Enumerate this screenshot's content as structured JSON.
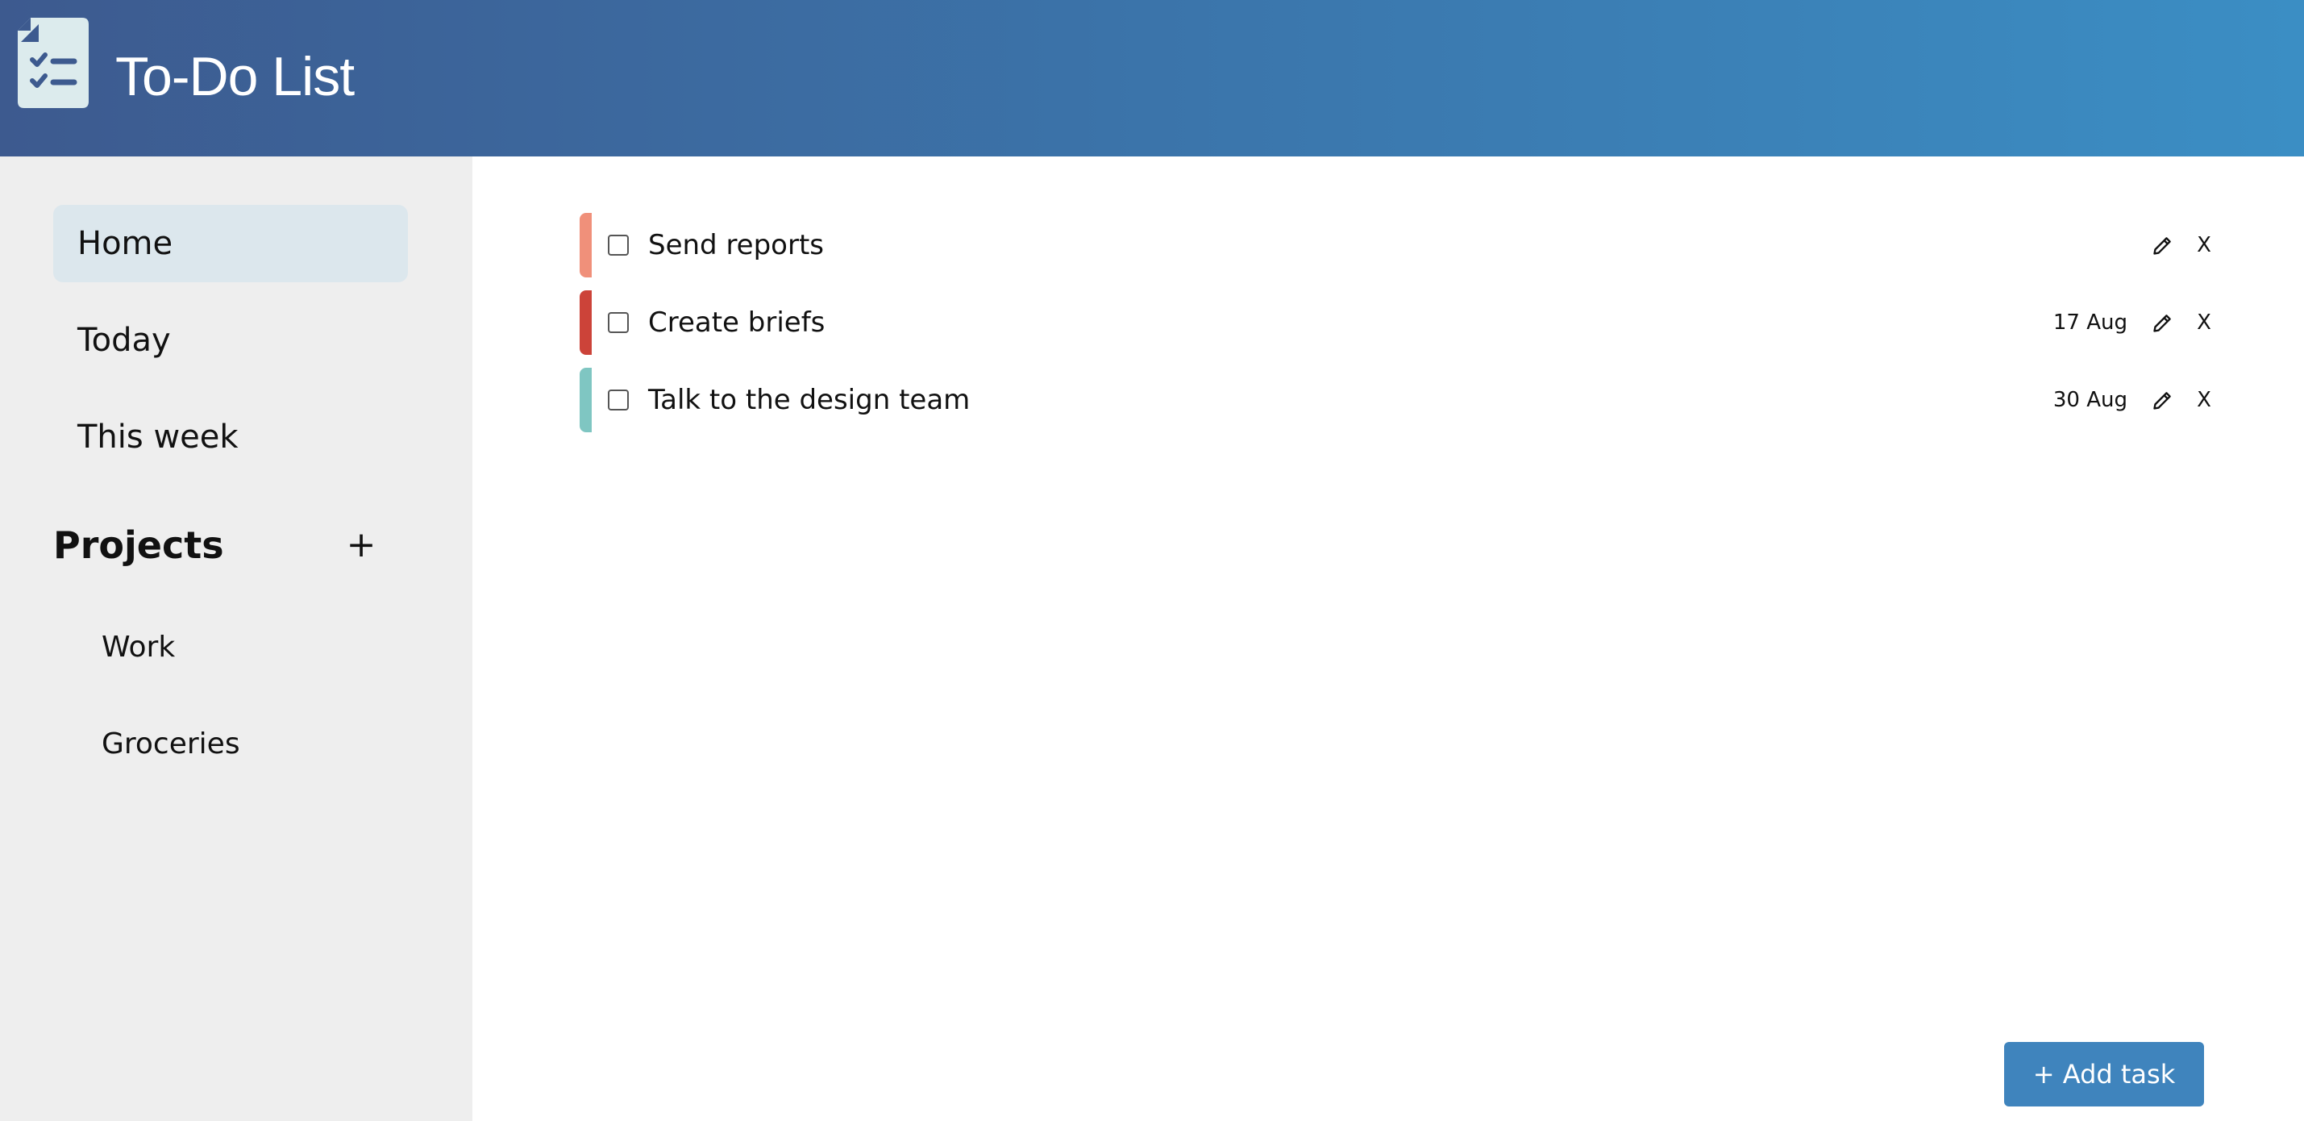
{
  "header": {
    "title": "To-Do List",
    "logo_icon": "checklist-document-icon",
    "gradient_colors": [
      "#3d5a8f",
      "#3b8ec4"
    ]
  },
  "sidebar": {
    "nav_items": [
      {
        "label": "Home",
        "active": true
      },
      {
        "label": "Today",
        "active": false
      },
      {
        "label": "This week",
        "active": false
      }
    ],
    "projects_heading": "Projects",
    "add_project_label": "+",
    "projects": [
      {
        "label": "Work"
      },
      {
        "label": "Groceries"
      }
    ]
  },
  "tasks": [
    {
      "title": "Send reports",
      "date": "",
      "color": "#f0907a",
      "completed": false,
      "edit_icon": "pencil-icon",
      "delete_label": "X"
    },
    {
      "title": "Create briefs",
      "date": "17 Aug",
      "color": "#cc4339",
      "completed": false,
      "edit_icon": "pencil-icon",
      "delete_label": "X"
    },
    {
      "title": "Talk to the design team",
      "date": "30 Aug",
      "color": "#7fc6c2",
      "completed": false,
      "edit_icon": "pencil-icon",
      "delete_label": "X"
    }
  ],
  "add_task_label": "+ Add task",
  "accent_color": "#3f84bd"
}
